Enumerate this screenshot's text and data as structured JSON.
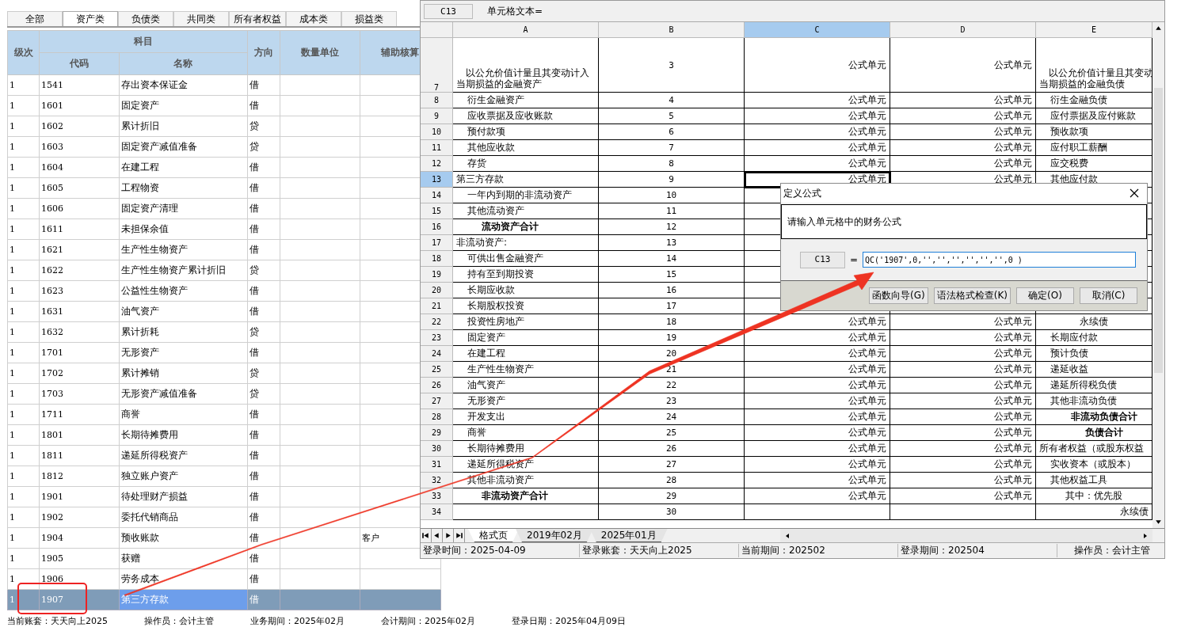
{
  "account_tabs": [
    {
      "label": "全部",
      "selected": false
    },
    {
      "label": "资产类",
      "selected": true
    },
    {
      "label": "负债类",
      "selected": false
    },
    {
      "label": "共同类",
      "selected": false
    },
    {
      "label": "所有者权益",
      "selected": false
    },
    {
      "label": "成本类",
      "selected": false
    },
    {
      "label": "损益类",
      "selected": false
    }
  ],
  "account_table": {
    "group_header": "科目",
    "columns": [
      "级次",
      "代码",
      "名称",
      "方向",
      "数量单位",
      "辅助核算"
    ],
    "rows": [
      {
        "level": "1",
        "code": "1541",
        "name": "存出资本保证金",
        "direction": "借",
        "selected": false
      },
      {
        "level": "1",
        "code": "1601",
        "name": "固定资产",
        "direction": "借",
        "selected": false
      },
      {
        "level": "1",
        "code": "1602",
        "name": "累计折旧",
        "direction": "贷",
        "selected": false
      },
      {
        "level": "1",
        "code": "1603",
        "name": "固定资产减值准备",
        "direction": "贷",
        "selected": false
      },
      {
        "level": "1",
        "code": "1604",
        "name": "在建工程",
        "direction": "借",
        "selected": false
      },
      {
        "level": "1",
        "code": "1605",
        "name": "工程物资",
        "direction": "借",
        "selected": false
      },
      {
        "level": "1",
        "code": "1606",
        "name": "固定资产清理",
        "direction": "借",
        "selected": false
      },
      {
        "level": "1",
        "code": "1611",
        "name": "未担保余值",
        "direction": "借",
        "selected": false
      },
      {
        "level": "1",
        "code": "1621",
        "name": "生产性生物资产",
        "direction": "借",
        "selected": false
      },
      {
        "level": "1",
        "code": "1622",
        "name": "生产性生物资产累计折旧",
        "direction": "贷",
        "selected": false
      },
      {
        "level": "1",
        "code": "1623",
        "name": "公益性生物资产",
        "direction": "借",
        "selected": false
      },
      {
        "level": "1",
        "code": "1631",
        "name": "油气资产",
        "direction": "借",
        "selected": false
      },
      {
        "level": "1",
        "code": "1632",
        "name": "累计折耗",
        "direction": "贷",
        "selected": false
      },
      {
        "level": "1",
        "code": "1701",
        "name": "无形资产",
        "direction": "借",
        "selected": false
      },
      {
        "level": "1",
        "code": "1702",
        "name": "累计摊销",
        "direction": "贷",
        "selected": false
      },
      {
        "level": "1",
        "code": "1703",
        "name": "无形资产减值准备",
        "direction": "贷",
        "selected": false
      },
      {
        "level": "1",
        "code": "1711",
        "name": "商誉",
        "direction": "借",
        "selected": false
      },
      {
        "level": "1",
        "code": "1801",
        "name": "长期待摊费用",
        "direction": "借",
        "selected": false
      },
      {
        "level": "1",
        "code": "1811",
        "name": "递延所得税资产",
        "direction": "借",
        "selected": false
      },
      {
        "level": "1",
        "code": "1812",
        "name": "独立账户资产",
        "direction": "借",
        "selected": false
      },
      {
        "level": "1",
        "code": "1901",
        "name": "待处理财产损益",
        "direction": "借",
        "selected": false
      },
      {
        "level": "1",
        "code": "1902",
        "name": "委托代销商品",
        "direction": "借",
        "selected": false
      },
      {
        "level": "1",
        "code": "1904",
        "name": "预收账款",
        "direction": "借",
        "auxiliary": "客户",
        "selected": false
      },
      {
        "level": "1",
        "code": "1905",
        "name": "获赠",
        "direction": "借",
        "selected": false
      },
      {
        "level": "1",
        "code": "1906",
        "name": "劳务成本",
        "direction": "借",
        "selected": false
      },
      {
        "level": "1",
        "code": "1907",
        "name": "第三方存款",
        "direction": "借",
        "selected": true
      }
    ]
  },
  "main_status_bar": [
    "当前账套：天天向上2025",
    "操作员：会计主管",
    "业务期间：2025年02月",
    "会计期间：2025年02月",
    "登录日期：2025年04月09日"
  ],
  "report_window": {
    "cell_ref": "C13",
    "cell_text_label": "单元格文本=",
    "columns": [
      {
        "label": "A",
        "selected": false
      },
      {
        "label": "B",
        "selected": false
      },
      {
        "label": "C",
        "selected": true
      },
      {
        "label": "D",
        "selected": false
      },
      {
        "label": "E",
        "selected": false
      }
    ],
    "rows": [
      {
        "num": "7",
        "selected": false,
        "a": {
          "kind": "wrap",
          "lines": [
            "以公允价值计量且其变动计入",
            "当期损益的金融资产"
          ]
        },
        "b": "3",
        "c": "公式单元",
        "d": "公式单元",
        "e": {
          "kind": "wrap",
          "lines": [
            "以公允价值计量且其变动",
            "当期损益的金融负债"
          ]
        }
      },
      {
        "num": "8",
        "selected": false,
        "a": {
          "kind": "indent",
          "text": "衍生金融资产"
        },
        "b": "4",
        "c": "公式单元",
        "d": "公式单元",
        "e": {
          "kind": "indent",
          "text": "衍生金融负债"
        }
      },
      {
        "num": "9",
        "selected": false,
        "a": {
          "kind": "indent",
          "text": "应收票据及应收账款"
        },
        "b": "5",
        "c": "公式单元",
        "d": "公式单元",
        "e": {
          "kind": "indent",
          "text": "应付票据及应付账款"
        }
      },
      {
        "num": "10",
        "selected": false,
        "a": {
          "kind": "indent",
          "text": "预付款项"
        },
        "b": "6",
        "c": "公式单元",
        "d": "公式单元",
        "e": {
          "kind": "indent",
          "text": "预收款项"
        }
      },
      {
        "num": "11",
        "selected": false,
        "a": {
          "kind": "indent",
          "text": "其他应收款"
        },
        "b": "7",
        "c": "公式单元",
        "d": "公式单元",
        "e": {
          "kind": "indent",
          "text": "应付职工薪酬"
        }
      },
      {
        "num": "12",
        "selected": false,
        "a": {
          "kind": "indent",
          "text": "存货"
        },
        "b": "8",
        "c": "公式单元",
        "d": "公式单元",
        "e": {
          "kind": "indent",
          "text": "应交税费"
        }
      },
      {
        "num": "13",
        "selected": true,
        "a": {
          "kind": "plain",
          "text": "第三方存款"
        },
        "b": "9",
        "c": "公式单元",
        "d": "公式单元",
        "e": {
          "kind": "indent",
          "text": "其他应付款"
        }
      },
      {
        "num": "14",
        "selected": false,
        "a": {
          "kind": "indent",
          "text": "一年内到期的非流动资产"
        },
        "b": "10"
      },
      {
        "num": "15",
        "selected": false,
        "a": {
          "kind": "indent",
          "text": "其他流动资产"
        },
        "b": "11"
      },
      {
        "num": "16",
        "selected": false,
        "a": {
          "kind": "total",
          "text": "流动资产合计"
        },
        "b": "12"
      },
      {
        "num": "17",
        "selected": false,
        "a": {
          "kind": "plain",
          "text": "非流动资产:"
        },
        "b": "13"
      },
      {
        "num": "18",
        "selected": false,
        "a": {
          "kind": "indent",
          "text": "可供出售金融资产"
        },
        "b": "14"
      },
      {
        "num": "19",
        "selected": false,
        "a": {
          "kind": "indent",
          "text": "持有至到期投资"
        },
        "b": "15"
      },
      {
        "num": "20",
        "selected": false,
        "a": {
          "kind": "indent",
          "text": "长期应收款"
        },
        "b": "16"
      },
      {
        "num": "21",
        "selected": false,
        "a": {
          "kind": "indent",
          "text": "长期股权投资"
        },
        "b": "17"
      },
      {
        "num": "22",
        "selected": false,
        "a": {
          "kind": "indent",
          "text": "投资性房地产"
        },
        "b": "18",
        "c": "公式单元",
        "d": "公式单元",
        "e": {
          "kind": "center",
          "text": "永续债"
        }
      },
      {
        "num": "23",
        "selected": false,
        "a": {
          "kind": "indent",
          "text": "固定资产"
        },
        "b": "19",
        "c": "公式单元",
        "d": "公式单元",
        "e": {
          "kind": "indent",
          "text": "长期应付款"
        }
      },
      {
        "num": "24",
        "selected": false,
        "a": {
          "kind": "indent",
          "text": "在建工程"
        },
        "b": "20",
        "c": "公式单元",
        "d": "公式单元",
        "e": {
          "kind": "indent",
          "text": "预计负债"
        }
      },
      {
        "num": "25",
        "selected": false,
        "a": {
          "kind": "indent",
          "text": "生产性生物资产"
        },
        "b": "21",
        "c": "公式单元",
        "d": "公式单元",
        "e": {
          "kind": "indent",
          "text": "递延收益"
        }
      },
      {
        "num": "26",
        "selected": false,
        "a": {
          "kind": "indent",
          "text": "油气资产"
        },
        "b": "22",
        "c": "公式单元",
        "d": "公式单元",
        "e": {
          "kind": "indent",
          "text": "递延所得税负债"
        }
      },
      {
        "num": "27",
        "selected": false,
        "a": {
          "kind": "indent",
          "text": "无形资产"
        },
        "b": "23",
        "c": "公式单元",
        "d": "公式单元",
        "e": {
          "kind": "indent",
          "text": "其他非流动负债"
        }
      },
      {
        "num": "28",
        "selected": false,
        "a": {
          "kind": "indent",
          "text": "开发支出"
        },
        "b": "24",
        "c": "公式单元",
        "d": "公式单元",
        "e": {
          "kind": "total",
          "text": "非流动负债合计"
        }
      },
      {
        "num": "29",
        "selected": false,
        "a": {
          "kind": "indent",
          "text": "商誉"
        },
        "b": "25",
        "c": "公式单元",
        "d": "公式单元",
        "e": {
          "kind": "total",
          "text": "负债合计"
        }
      },
      {
        "num": "30",
        "selected": false,
        "a": {
          "kind": "indent",
          "text": "长期待摊费用"
        },
        "b": "26",
        "c": "公式单元",
        "d": "公式单元",
        "e": {
          "kind": "plain",
          "text": "所有者权益（或股东权益"
        }
      },
      {
        "num": "31",
        "selected": false,
        "a": {
          "kind": "indent",
          "text": "递延所得税资产"
        },
        "b": "27",
        "c": "公式单元",
        "d": "公式单元",
        "e": {
          "kind": "indent",
          "text": "实收资本（或股本）"
        }
      },
      {
        "num": "32",
        "selected": false,
        "a": {
          "kind": "indent",
          "text": "其他非流动资产"
        },
        "b": "28",
        "c": "公式单元",
        "d": "公式单元",
        "e": {
          "kind": "indent",
          "text": "其他权益工具"
        }
      },
      {
        "num": "33",
        "selected": false,
        "a": {
          "kind": "total",
          "text": "非流动资产合计"
        },
        "b": "29",
        "c": "公式单元",
        "d": "公式单元",
        "e": {
          "kind": "center",
          "text": "其中：优先股"
        }
      },
      {
        "num": "34",
        "selected": false,
        "b": "30",
        "e": {
          "kind": "right",
          "text": "永续债"
        }
      }
    ],
    "sheet_tabs": [
      {
        "label": "格式页",
        "selected": true
      },
      {
        "label": "2019年02月",
        "selected": false
      },
      {
        "label": "2025年01月",
        "selected": false
      }
    ],
    "status_bar": [
      "登录时间：2025-04-09",
      "登录账套：天天向上2025",
      "当前期间：202502",
      "登录期间：202504",
      "操作员：会计主管"
    ]
  },
  "formula_dialog": {
    "title": "定义公式",
    "prompt": "请输入单元格中的财务公式",
    "cell_ref": "C13",
    "equals": "=",
    "formula": "QC('1907',0,'','','','','','',0 )",
    "buttons": [
      "函数向导(G)",
      "语法格式检查(K)",
      "确定(O)",
      "取消(C)"
    ]
  }
}
